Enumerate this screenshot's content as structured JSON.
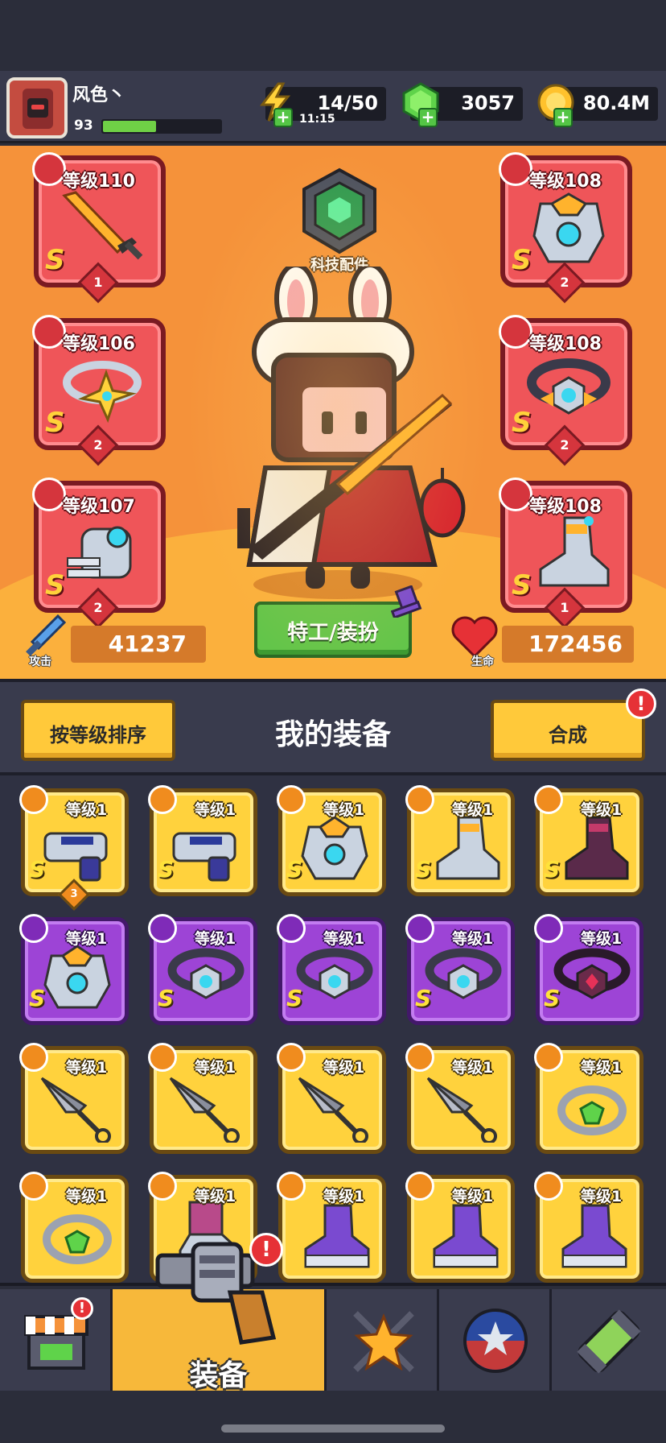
{
  "player": {
    "name": "风色丶",
    "level": "93",
    "xp_fraction": 0.45
  },
  "resources": {
    "energy": "14/50",
    "energy_timer": "11:15",
    "gems": "3057",
    "coins": "80.4M"
  },
  "hero": {
    "tech_label": "科技配件",
    "slots": [
      {
        "level": "等级110",
        "rank": "S",
        "stars": "1",
        "category": "weapon-icon",
        "item": "sword-icon"
      },
      {
        "level": "等级106",
        "rank": "S",
        "stars": "2",
        "category": "necklace-icon",
        "item": "necklace-icon"
      },
      {
        "level": "等级107",
        "rank": "S",
        "stars": "2",
        "category": "glove-icon",
        "item": "gauntlet-icon"
      },
      {
        "level": "等级108",
        "rank": "S",
        "stars": "2",
        "category": "armor-icon",
        "item": "armor-icon"
      },
      {
        "level": "等级108",
        "rank": "S",
        "stars": "2",
        "category": "belt-icon",
        "item": "belt-icon"
      },
      {
        "level": "等级108",
        "rank": "S",
        "stars": "1",
        "category": "boots-icon",
        "item": "boots-icon"
      }
    ],
    "attack_label": "攻击",
    "attack_value": "41237",
    "hp_label": "生命",
    "hp_value": "172456",
    "agent_button": "特工/装扮"
  },
  "equipment": {
    "sort_button": "按等级排序",
    "title": "我的装备",
    "merge_button": "合成",
    "badge": "!",
    "items": [
      {
        "level": "等级1",
        "rarity": "gold",
        "rank": "S",
        "item": "blaster-icon",
        "stars": "3"
      },
      {
        "level": "等级1",
        "rarity": "gold",
        "rank": "S",
        "item": "blaster-icon"
      },
      {
        "level": "等级1",
        "rarity": "gold",
        "rank": "S",
        "item": "armor-icon"
      },
      {
        "level": "等级1",
        "rarity": "gold",
        "rank": "S",
        "item": "boots-icon"
      },
      {
        "level": "等级1",
        "rarity": "gold",
        "rank": "S",
        "item": "dark-boots-icon"
      },
      {
        "level": "等级1",
        "rarity": "purple",
        "rank": "S",
        "item": "armor-icon"
      },
      {
        "level": "等级1",
        "rarity": "purple",
        "rank": "S",
        "item": "belt-icon"
      },
      {
        "level": "等级1",
        "rarity": "purple",
        "rank": "S",
        "item": "belt-icon"
      },
      {
        "level": "等级1",
        "rarity": "purple",
        "rank": "S",
        "item": "belt-icon"
      },
      {
        "level": "等级1",
        "rarity": "purple",
        "rank": "S",
        "item": "dark-belt-icon"
      },
      {
        "level": "等级1",
        "rarity": "gold",
        "rank": "",
        "item": "kunai-icon"
      },
      {
        "level": "等级1",
        "rarity": "gold",
        "rank": "",
        "item": "kunai-icon"
      },
      {
        "level": "等级1",
        "rarity": "gold",
        "rank": "",
        "item": "kunai-icon"
      },
      {
        "level": "等级1",
        "rarity": "gold",
        "rank": "",
        "item": "kunai-icon"
      },
      {
        "level": "等级1",
        "rarity": "gold",
        "rank": "",
        "item": "ring-icon"
      },
      {
        "level": "等级1",
        "rarity": "gold",
        "rank": "",
        "item": "ring-icon"
      },
      {
        "level": "等级1",
        "rarity": "gold",
        "rank": "",
        "item": "pipe-boots-icon"
      },
      {
        "level": "等级1",
        "rarity": "gold",
        "rank": "",
        "item": "purple-boots-icon"
      },
      {
        "level": "等级1",
        "rarity": "gold",
        "rank": "",
        "item": "purple-boots-icon"
      },
      {
        "level": "等级1",
        "rarity": "gold",
        "rank": "",
        "item": "purple-boots-icon"
      }
    ]
  },
  "nav": {
    "tabs": [
      {
        "name": "shop",
        "icon": "shop-icon"
      },
      {
        "name": "equipment",
        "label": "装备",
        "icon": "revolver-icon",
        "active": true
      },
      {
        "name": "talent",
        "icon": "star-swords-icon"
      },
      {
        "name": "pets",
        "icon": "star-ball-icon"
      },
      {
        "name": "gene",
        "icon": "dna-capsule-icon"
      }
    ]
  },
  "colors": {
    "hero_bg": "#f5923a",
    "gold_tile": "#ffd23d",
    "purple_tile": "#9d44d6",
    "accent_green": "#63c54a",
    "badge_red": "#e63136"
  }
}
